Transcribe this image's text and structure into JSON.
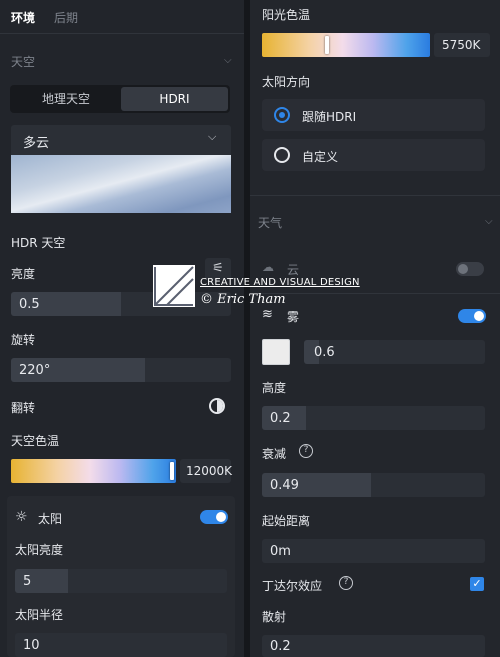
{
  "left": {
    "tabs": [
      "环境",
      "后期"
    ],
    "sky_section": "天空",
    "segment": [
      "地理天空",
      "HDRI"
    ],
    "dropdown_value": "多云",
    "hdr_sky_title": "HDR 天空",
    "brightness": {
      "label": "亮度",
      "value": "0.5",
      "level": 0.5
    },
    "rotation": {
      "label": "旋转",
      "value": "220°",
      "level": 0.61
    },
    "flip_label": "翻转",
    "sky_color_temp": {
      "label": "天空色温",
      "value": "12000K",
      "handle": 1.0
    },
    "sun": {
      "title": "太阳",
      "brightness": {
        "label": "太阳亮度",
        "value": "5",
        "level": 0.25
      },
      "radius": {
        "label": "太阳半径",
        "value": "10"
      }
    }
  },
  "right": {
    "sun_color_temp": {
      "label": "阳光色温",
      "value": "5750K",
      "handle": 0.38
    },
    "sun_direction_label": "太阳方向",
    "radio_follow": "跟随HDRI",
    "radio_custom": "自定义",
    "weather_section": "天气",
    "cloud_label": "云",
    "fog": {
      "label": "雾",
      "swatch_color": "#ececec",
      "density_value": "0.6",
      "density_level": 0.08
    },
    "height": {
      "label": "高度",
      "value": "0.2",
      "level": 0.2
    },
    "attenuation": {
      "label": "衰减",
      "value": "0.49",
      "level": 0.49
    },
    "start_distance": {
      "label": "起始距离",
      "value": "0m"
    },
    "tyndall_label": "丁达尔效应",
    "scatter": {
      "label": "散射",
      "value": "0.2"
    }
  },
  "watermark": {
    "line1": "CREATIVE AND VISUAL DESIGN",
    "line2": "© Eric Tham"
  },
  "colors": {
    "accent": "#2f86e8",
    "panel": "#22252b",
    "track": "#2b2f36"
  }
}
